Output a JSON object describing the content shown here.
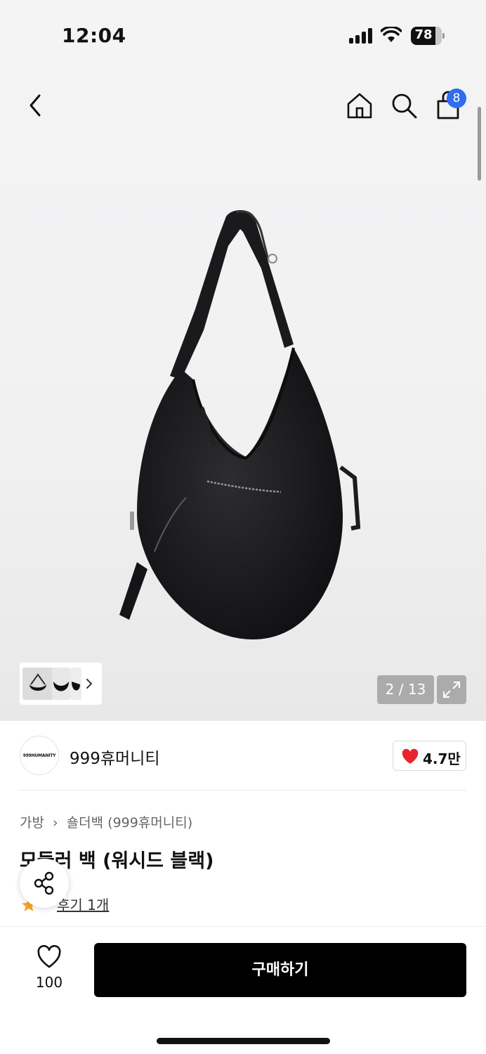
{
  "status_bar": {
    "time": "12:04",
    "battery": "78"
  },
  "nav": {
    "cart_badge": "8"
  },
  "gallery": {
    "counter": "2 / 13",
    "background": "#f2f2f3"
  },
  "brand": {
    "logo_text": "999HUMANITY",
    "name": "999휴머니티",
    "likes": "4.7만",
    "like_color": "#e8242c"
  },
  "product": {
    "breadcrumb": [
      "가방",
      "숄더백 (999휴머니티)"
    ],
    "title": "모듈러 백 (워시드 블랙)",
    "review_rating_color": "#f5a623",
    "review_text": "후기 1개"
  },
  "bottom": {
    "wish_count": "100",
    "buy_label": "구매하기",
    "buy_color": "#000000"
  },
  "icons": {
    "back": "chevron-left-icon",
    "home": "home-icon",
    "search": "search-icon",
    "cart": "shopping-bag-icon",
    "expand": "expand-icon",
    "share": "share-icon",
    "heart": "heart-icon",
    "star": "star-icon"
  }
}
